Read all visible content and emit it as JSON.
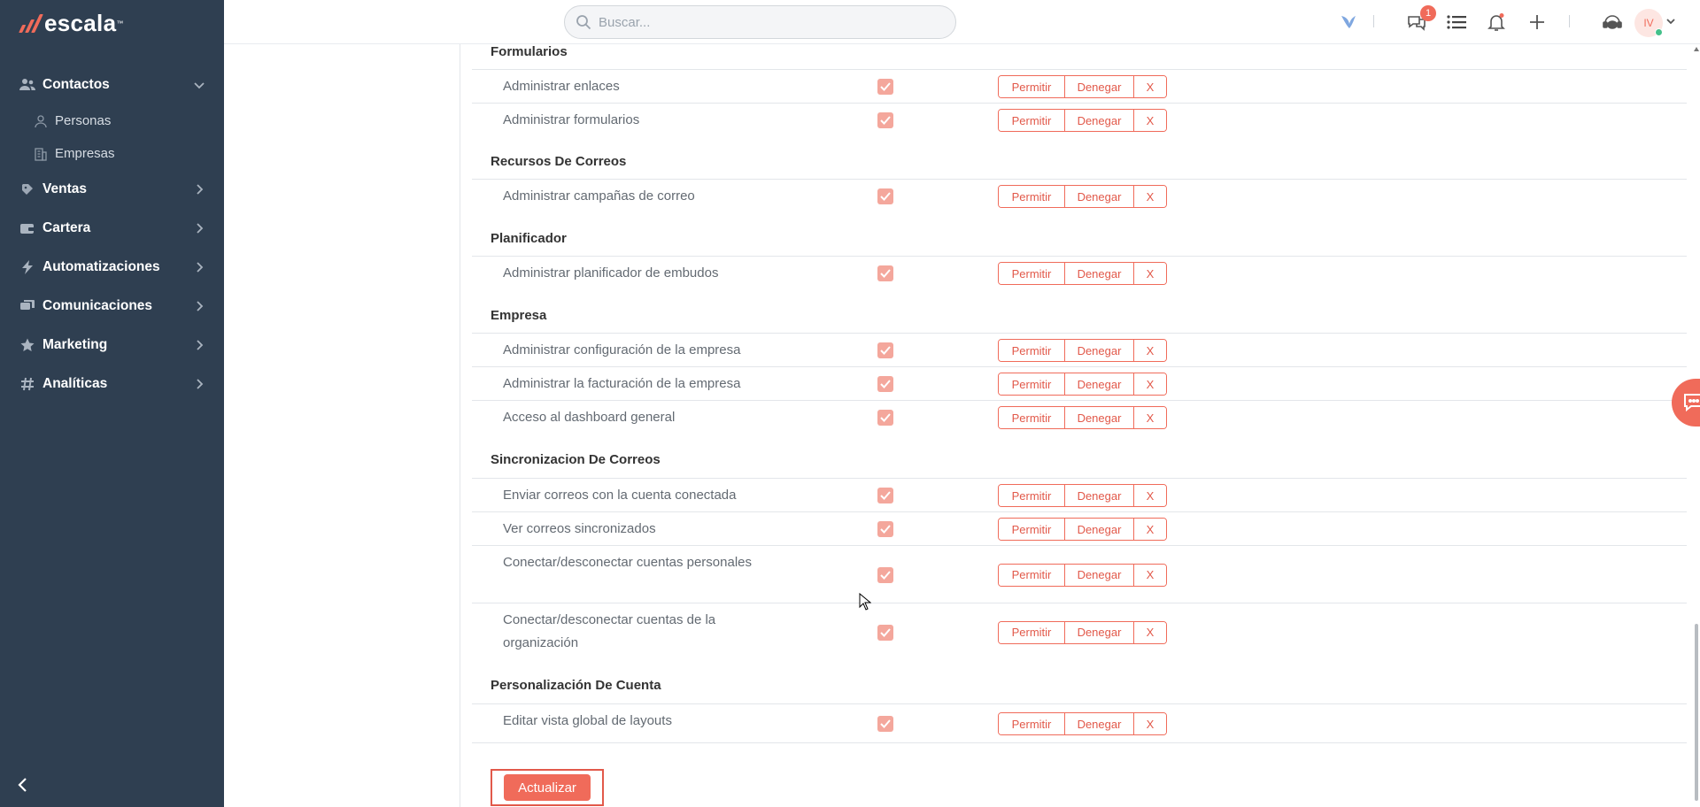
{
  "app": {
    "logo_text": "escala",
    "logo_tm": "™"
  },
  "colors": {
    "sidebar_bg": "#2f3f51",
    "accent": "#f06b5a",
    "checkbox_fill": "#f4a79c"
  },
  "sidebar": {
    "items": [
      {
        "label": "Contactos",
        "icon": "users-icon",
        "expanded": true
      },
      {
        "label": "Ventas",
        "icon": "sales-icon"
      },
      {
        "label": "Cartera",
        "icon": "wallet-icon"
      },
      {
        "label": "Automatizaciones",
        "icon": "bolt-icon"
      },
      {
        "label": "Comunicaciones",
        "icon": "chat-icon"
      },
      {
        "label": "Marketing",
        "icon": "star-icon"
      },
      {
        "label": "Analíticas",
        "icon": "hash-icon"
      }
    ],
    "subitems": [
      {
        "label": "Personas",
        "icon": "person-icon"
      },
      {
        "label": "Empresas",
        "icon": "building-icon"
      }
    ],
    "collapse_icon": "chevron-left-icon"
  },
  "topbar": {
    "search_placeholder": "Buscar...",
    "messages_badge": "1",
    "avatar_initials": "IV",
    "icons": [
      "bird-icon",
      "messages-icon",
      "list-icon",
      "bell-icon",
      "plus-icon",
      "support-icon"
    ]
  },
  "permission_buttons": {
    "allow": "Permitir",
    "deny": "Denegar",
    "clear": "X"
  },
  "sections": [
    {
      "title": "Formularios",
      "rows": [
        "Administrar enlaces",
        "Administrar formularios"
      ]
    },
    {
      "title": "Recursos De Correos",
      "rows": [
        "Administrar campañas de correo"
      ]
    },
    {
      "title": "Planificador",
      "rows": [
        "Administrar planificador de embudos"
      ]
    },
    {
      "title": "Empresa",
      "rows": [
        "Administrar configuración de la empresa",
        "Administrar la facturación de la empresa",
        "Acceso al dashboard general"
      ]
    },
    {
      "title": "Sincronizacion De Correos",
      "rows": [
        "Enviar correos con la cuenta conectada",
        "Ver correos sincronizados",
        "Conectar/desconectar cuentas personales",
        "Conectar/desconectar cuentas de la organización"
      ]
    },
    {
      "title": "Personalización De Cuenta",
      "rows": [
        "Editar vista global de layouts"
      ]
    }
  ],
  "update_button": "Actualizar"
}
